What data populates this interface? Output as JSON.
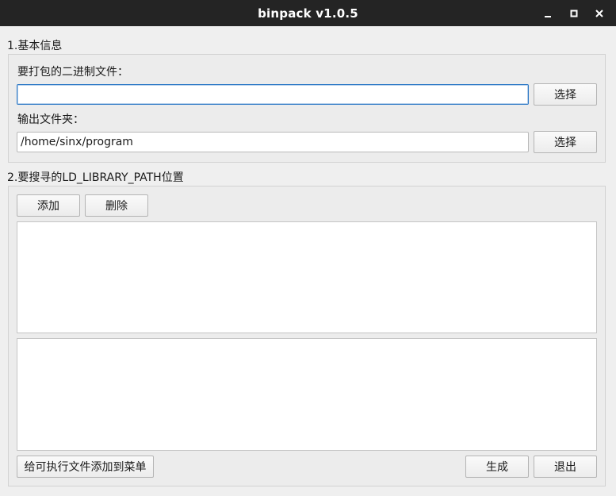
{
  "window": {
    "title": "binpack v1.0.5",
    "controls": {
      "minimize_icon": "minimize-icon",
      "maximize_icon": "maximize-icon",
      "close_icon": "close-icon"
    }
  },
  "basic_info": {
    "section_title": "1.基本信息",
    "binary_label": "要打包的二进制文件：",
    "binary_value": "",
    "binary_choose_label": "选择",
    "output_label": "输出文件夹：",
    "output_value": "/home/sinx/program",
    "output_choose_label": "选择"
  },
  "ld_path": {
    "section_title": "2.要搜寻的LD_LIBRARY_PATH位置",
    "add_label": "添加",
    "delete_label": "删除",
    "path_list": [],
    "output_list": []
  },
  "footer": {
    "add_menu_label": "给可执行文件添加到菜单",
    "generate_label": "生成",
    "exit_label": "退出"
  },
  "colors": {
    "titlebar_bg": "#242424",
    "window_bg": "#efefef",
    "focus_border": "#2e79c6"
  }
}
